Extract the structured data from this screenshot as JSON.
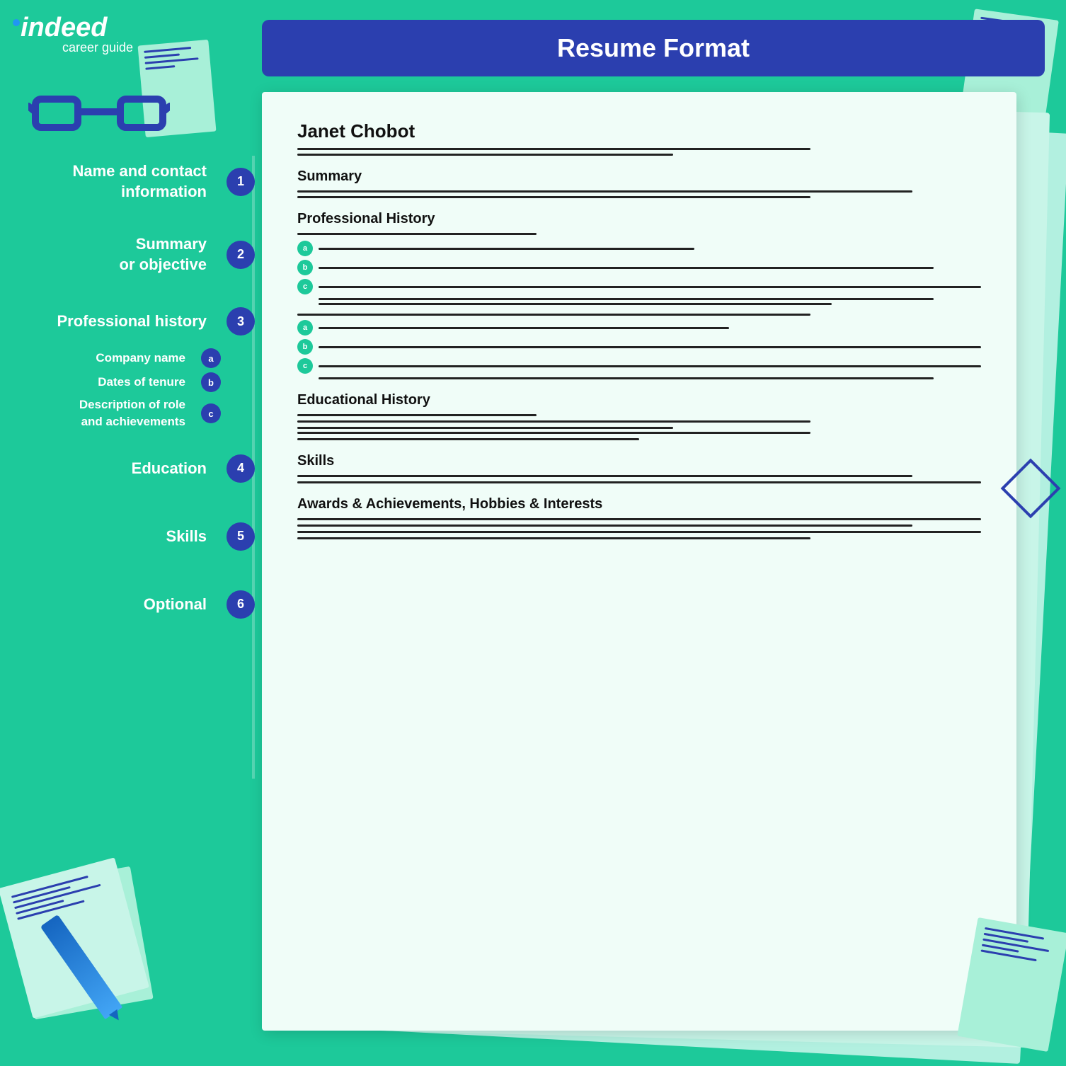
{
  "header": {
    "title": "Resume Format"
  },
  "logo": {
    "brand": "indeed",
    "tagline": "career guide"
  },
  "sidebar": {
    "items": [
      {
        "id": 1,
        "label": "Name and contact\ninformation",
        "step": "1"
      },
      {
        "id": 2,
        "label": "Summary\nor objective",
        "step": "2"
      },
      {
        "id": 3,
        "label": "Professional history",
        "step": "3",
        "subs": [
          {
            "badge": "a",
            "label": "Company name"
          },
          {
            "badge": "b",
            "label": "Dates of tenure"
          },
          {
            "badge": "c",
            "label": "Description of role\nand achievements"
          }
        ]
      },
      {
        "id": 4,
        "label": "Education",
        "step": "4"
      },
      {
        "id": 5,
        "label": "Skills",
        "step": "5"
      },
      {
        "id": 6,
        "label": "Optional",
        "step": "6"
      }
    ]
  },
  "resume": {
    "name": "Janet Chobot",
    "sections": [
      {
        "title": "Summary"
      },
      {
        "title": "Professional History"
      },
      {
        "title": "Educational History"
      },
      {
        "title": "Skills"
      },
      {
        "title": "Awards & Achievements, Hobbies & Interests"
      }
    ]
  },
  "colors": {
    "bg": "#1dc99a",
    "accent": "#2b3faf",
    "white": "#ffffff",
    "paper": "#f0fdf8",
    "paper_back1": "#c8f5e8",
    "paper_back2": "#b2f0e0"
  }
}
